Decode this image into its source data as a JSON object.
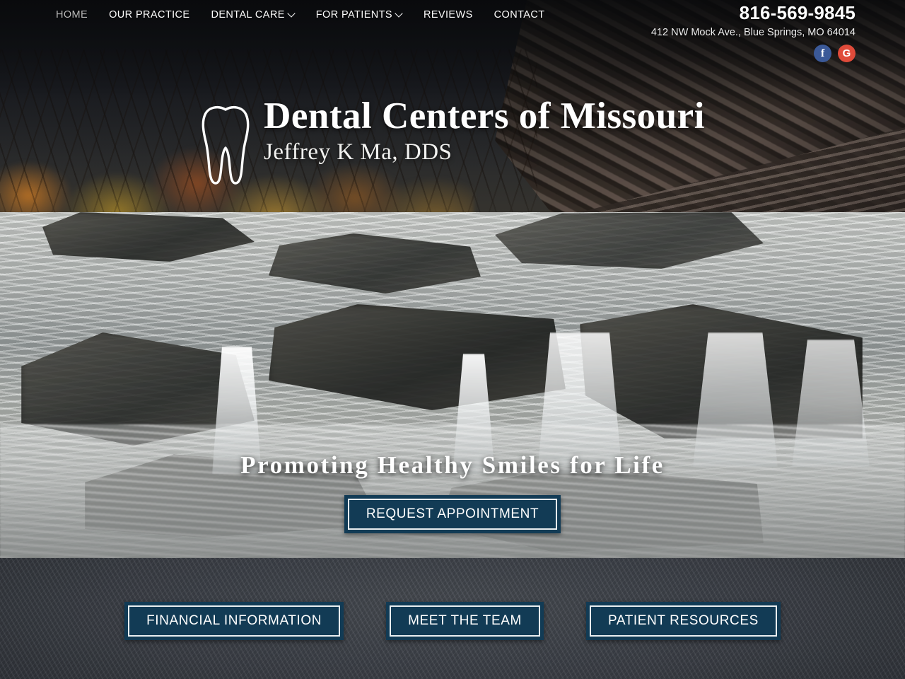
{
  "nav": {
    "items": [
      {
        "label": "HOME",
        "active": true,
        "caret": false
      },
      {
        "label": "OUR PRACTICE",
        "active": false,
        "caret": false
      },
      {
        "label": "DENTAL CARE",
        "active": false,
        "caret": true
      },
      {
        "label": "FOR PATIENTS",
        "active": false,
        "caret": true
      },
      {
        "label": "REVIEWS",
        "active": false,
        "caret": false
      },
      {
        "label": "CONTACT",
        "active": false,
        "caret": false
      }
    ]
  },
  "contact": {
    "phone": "816-569-9845",
    "address": "412 NW Mock Ave., Blue Springs, MO 64014",
    "socials": [
      {
        "name": "facebook",
        "glyph": "f"
      },
      {
        "name": "google",
        "glyph": "G"
      }
    ]
  },
  "logo": {
    "icon": "tooth-icon",
    "title": "Dental Centers of Missouri",
    "subtitle": "Jeffrey K Ma, DDS"
  },
  "hero": {
    "tagline": "Promoting Healthy Smiles for Life",
    "cta_label": "REQUEST APPOINTMENT"
  },
  "bottom_bar": {
    "buttons": [
      {
        "label": "FINANCIAL INFORMATION"
      },
      {
        "label": "MEET THE TEAM"
      },
      {
        "label": "PATIENT RESOURCES"
      }
    ]
  },
  "colors": {
    "button_fill": "#123b55",
    "button_border": "#e9eef0",
    "facebook": "#3b5998",
    "google": "#e04b3a",
    "nav_text": "#ffffff",
    "nav_active_text": "#b9b9b9"
  }
}
